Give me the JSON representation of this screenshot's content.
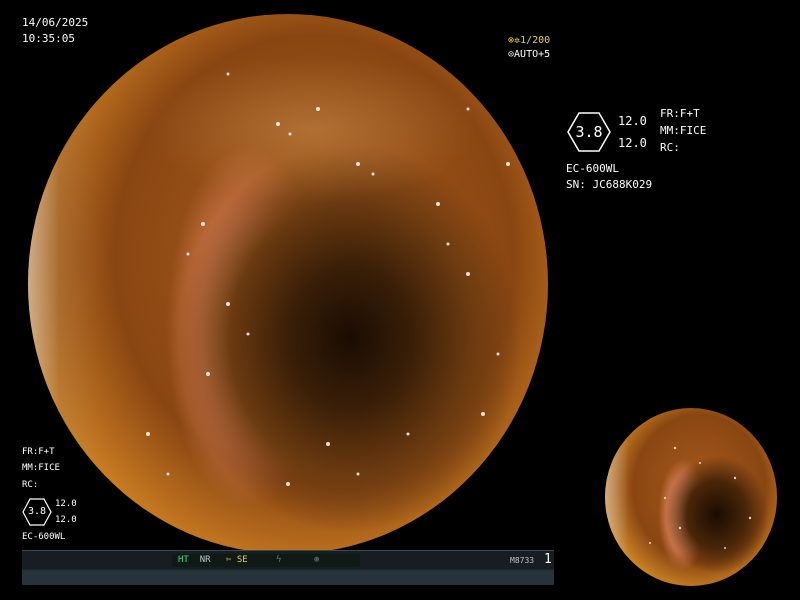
{
  "datetime": {
    "date": "14/06/2025",
    "time": "10:35:05"
  },
  "shutter": {
    "value": "1/200",
    "auto_label": "AUTO+5"
  },
  "info_panel": {
    "zoom_value": "3.8",
    "param_a": "12.0",
    "param_b": "12.0",
    "fr": "FR:F+T",
    "mm": "MM:FICE",
    "rc": "RC:",
    "scope_model": "EC-600WL",
    "serial": "SN: JC688K029"
  },
  "info_panel_small": {
    "fr": "FR:F+T",
    "mm": "MM:FICE",
    "rc": "RC:",
    "zoom_value": "3.8",
    "param_a": "12.0",
    "param_b": "12.0",
    "scope_model": "EC-600WL"
  },
  "status_bar": {
    "ht": "HT",
    "nr": "NR",
    "se": "SE",
    "code": "M8733",
    "page": "1"
  },
  "colors": {
    "shutter_accent": "#e8d34a",
    "status_green": "#3fe07a"
  },
  "icons": [
    "shutter-icon",
    "auto-icon",
    "scissors-icon",
    "lightning-icon",
    "target-icon"
  ]
}
